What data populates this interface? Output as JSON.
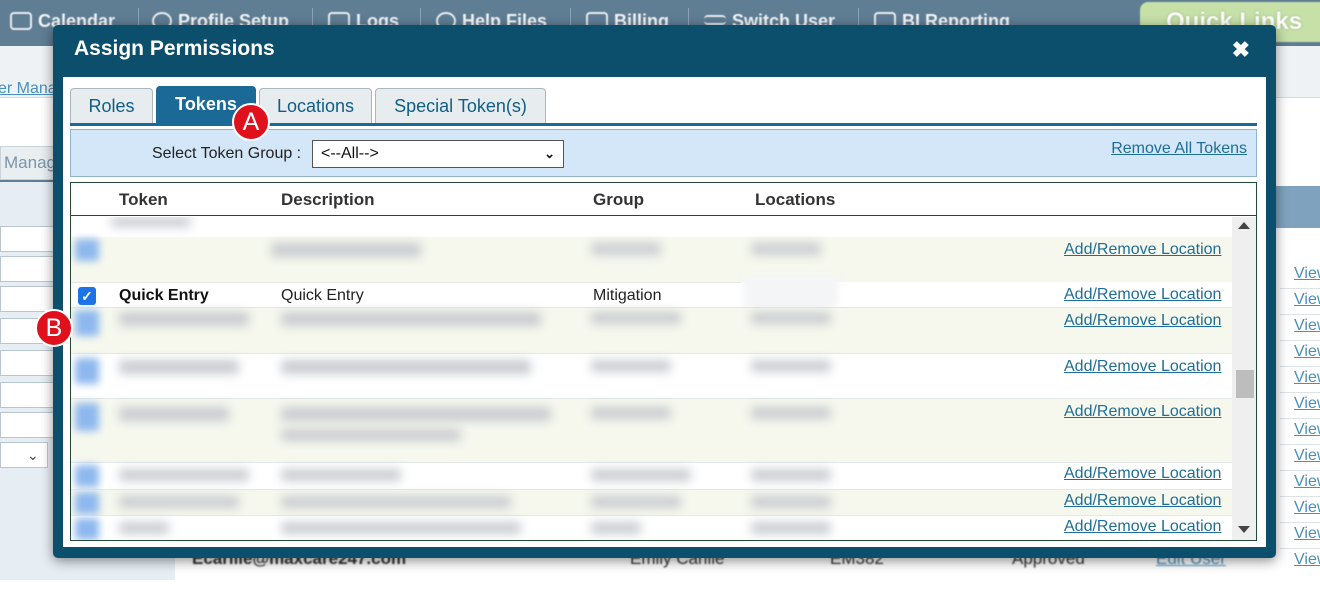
{
  "nav": {
    "items": [
      {
        "label": "Calendar",
        "icon": "calendar-icon"
      },
      {
        "label": "Profile Setup",
        "icon": "profile-icon"
      },
      {
        "label": "Logs",
        "icon": "logs-icon"
      },
      {
        "label": "Help Files",
        "icon": "help-icon"
      },
      {
        "label": "Billing",
        "icon": "billing-icon"
      },
      {
        "label": "Switch User",
        "icon": "switch-user-icon"
      },
      {
        "label": "BI Reporting",
        "icon": "bi-reporting-icon"
      }
    ],
    "quick_links": "Quick Links"
  },
  "background": {
    "user_link": "er Mana",
    "manage_tab": "Manag",
    "view_link": "View",
    "bottom_row": {
      "email": "Ecarlile@maxcare247.com",
      "name": "Emily Carlile",
      "code": "EM382",
      "status": "Approved",
      "action": "Edit User"
    }
  },
  "modal": {
    "title": "Assign Permissions",
    "close_glyph": "✖",
    "tabs": [
      {
        "label": "Roles",
        "active": false
      },
      {
        "label": "Tokens",
        "active": true
      },
      {
        "label": "Locations",
        "active": false
      },
      {
        "label": "Special Token(s)",
        "active": false
      }
    ],
    "filter": {
      "label": "Select Token Group :",
      "selected": "<--All-->",
      "remove_all": "Remove All Tokens"
    },
    "grid": {
      "columns": {
        "token": "Token",
        "description": "Description",
        "group": "Group",
        "locations": "Locations"
      },
      "add_remove_label": "Add/Remove Location",
      "highlighted_row": {
        "token": "Quick Entry",
        "description": "Quick Entry",
        "group": "Mitigation",
        "checked": true
      }
    }
  },
  "markers": {
    "a": "A",
    "b": "B"
  },
  "colors": {
    "modal_bg": "#0b4f6c",
    "active_tab": "#1a6996",
    "marker": "#e0101c",
    "filter_bg": "#d3e7f8",
    "link": "#1f6e96"
  }
}
